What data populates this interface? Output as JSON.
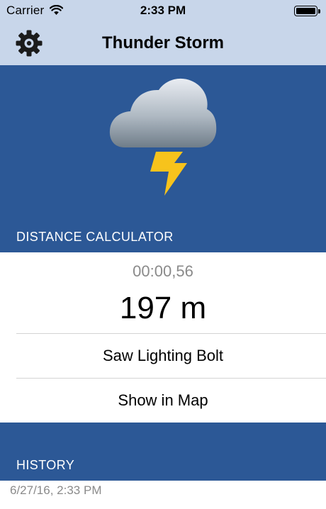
{
  "status_bar": {
    "carrier": "Carrier",
    "time": "2:33 PM",
    "battery_level": 1.0
  },
  "nav": {
    "title": "Thunder Storm",
    "settings_icon": "gear-icon"
  },
  "hero": {
    "icon": "thunderstorm-icon"
  },
  "distance_calculator": {
    "header": "DISTANCE CALCULATOR",
    "timer": "00:00,56",
    "distance": "197 m",
    "saw_lightning_button": "Saw Lighting Bolt",
    "show_map_button": "Show in Map"
  },
  "history": {
    "header": "HISTORY",
    "items": [
      {
        "label": "6/27/16, 2:33 PM"
      }
    ]
  },
  "colors": {
    "nav_background": "#c8d6ea",
    "accent_blue": "#2c5896",
    "bolt_yellow": "#f7c31c",
    "muted_text": "#8a8a8a"
  }
}
